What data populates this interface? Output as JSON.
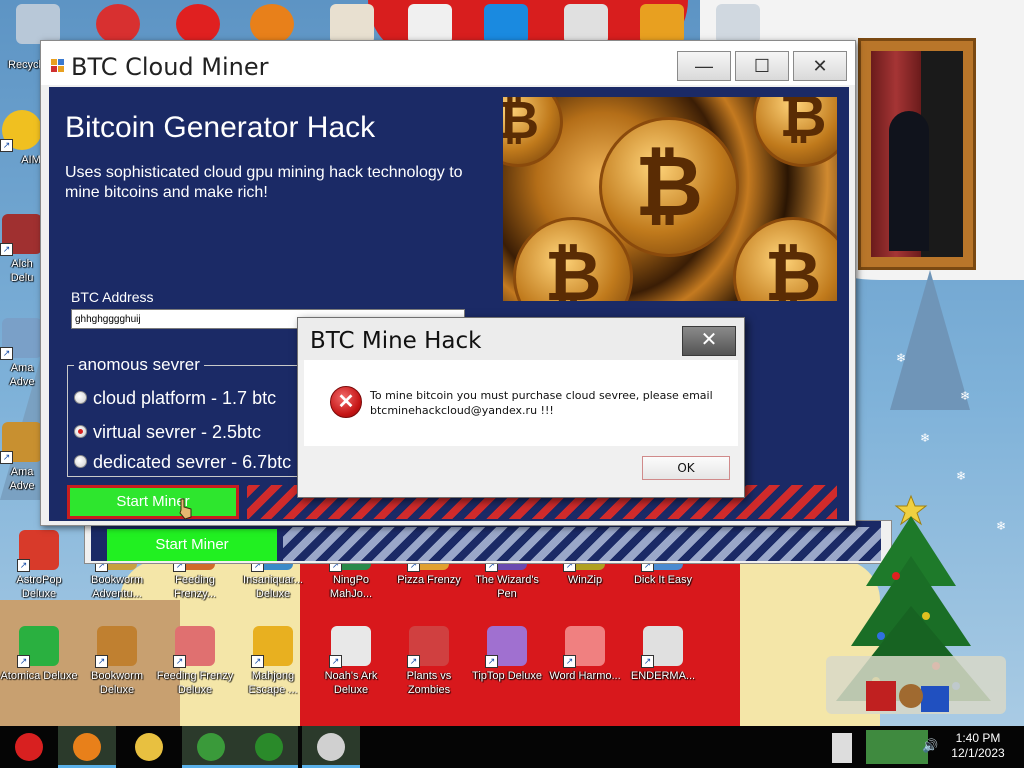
{
  "desktop": {
    "left_icons": [
      {
        "label": "Recycle",
        "icon": "recycle-bin-icon"
      },
      {
        "label": "AIM",
        "icon": "aim-icon"
      },
      {
        "label": "Alch Delu",
        "icon": "alchemy-icon"
      },
      {
        "label": "Ama Adve",
        "icon": "amazing-adventures-icon"
      },
      {
        "label": "Ama Adve",
        "icon": "amazing-adventures-2-icon"
      }
    ],
    "row1": [
      {
        "label": "AstroPop Deluxe",
        "color": "#d83a2a"
      },
      {
        "label": "Bookworm Adventu...",
        "color": "#c8a040"
      },
      {
        "label": "Feeding Frenzy...",
        "color": "#d06a2a"
      },
      {
        "label": "Insaniquar... Deluxe",
        "color": "#3a8ac8"
      },
      {
        "label": "NingPo MahJo...",
        "color": "#2a8a4a"
      },
      {
        "label": "Pizza Frenzy",
        "color": "#e0a030"
      },
      {
        "label": "The Wizard's Pen",
        "color": "#6a4ab0"
      },
      {
        "label": "WinZip",
        "color": "#b0a020"
      },
      {
        "label": "Dick It Easy",
        "color": "#4a8ad0"
      }
    ],
    "row2": [
      {
        "label": "Atomica Deluxe",
        "color": "#2ab040"
      },
      {
        "label": "Bookworm Deluxe",
        "color": "#c08030"
      },
      {
        "label": "Feeding Frenzy Deluxe",
        "color": "#e07070"
      },
      {
        "label": "Mahjong Escape ...",
        "color": "#e8b020"
      },
      {
        "label": "Noah's Ark Deluxe",
        "color": "#e8e8e8"
      },
      {
        "label": "Plants vs Zombies",
        "color": "#d04040"
      },
      {
        "label": "TipTop Deluxe",
        "color": "#a070d0"
      },
      {
        "label": "Word Harmo...",
        "color": "#f08080"
      },
      {
        "label": "ENDERMA...",
        "color": "#e0e0e0"
      }
    ]
  },
  "main_window": {
    "title": "BTC Cloud Miner",
    "heading": "Bitcoin Generator Hack",
    "description": "Uses sophisticated cloud gpu mining hack technology to mine bitcoins and make rich!",
    "address_label": "BTC Address",
    "address_value": "ghhghgggghuij",
    "group_title": "anomous sevrer",
    "options": [
      {
        "label": "cloud platform - 1.7 btc",
        "selected": false
      },
      {
        "label": "virtual sevrer - 2.5btc",
        "selected": true
      },
      {
        "label": "dedicated sevrer - 6.7btc",
        "selected": false
      }
    ],
    "start_button": "Start Miner",
    "back_start_button": "Start Miner",
    "coin_symbol": "₿"
  },
  "dialog": {
    "title": "BTC Mine Hack",
    "message": "To mine bitcoin you must purchase cloud sevree, please email btcminehackcloud@yandex.ru !!!",
    "ok_label": "OK",
    "close_glyph": "✕",
    "icon": "error-icon"
  },
  "window_controls": {
    "min": "—",
    "max": "☐",
    "close": "✕"
  },
  "taskbar": {
    "items": [
      {
        "name": "santa",
        "color": "#d82020"
      },
      {
        "name": "firefox",
        "color": "#e8801a"
      },
      {
        "name": "file-explorer",
        "color": "#e8c040"
      },
      {
        "name": "chrome",
        "color": "#3a9a3a"
      },
      {
        "name": "tree-app",
        "color": "#2a8a2a"
      },
      {
        "name": "window-app",
        "color": "#d0d0d0"
      }
    ],
    "time": "1:40 PM",
    "date": "12/1/2023",
    "volume_glyph": "🔊"
  }
}
